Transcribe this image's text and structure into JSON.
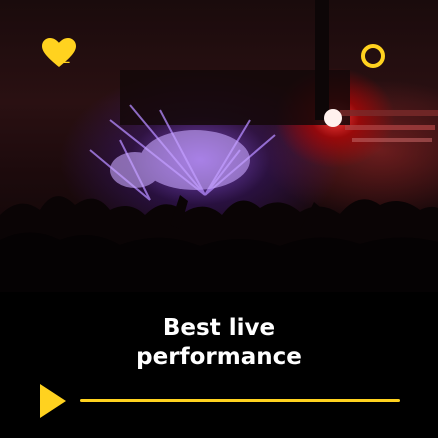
{
  "likes": {
    "count": "1"
  },
  "post": {
    "title_line1": "Best live",
    "title_line2": "performance"
  },
  "player": {
    "progress": 1.0
  },
  "icons": {
    "like": "heart-icon",
    "status": "ring-icon",
    "play": "play-icon"
  },
  "colors": {
    "accent": "#ffd21f",
    "panel": "#000000",
    "text": "#ffffff"
  }
}
